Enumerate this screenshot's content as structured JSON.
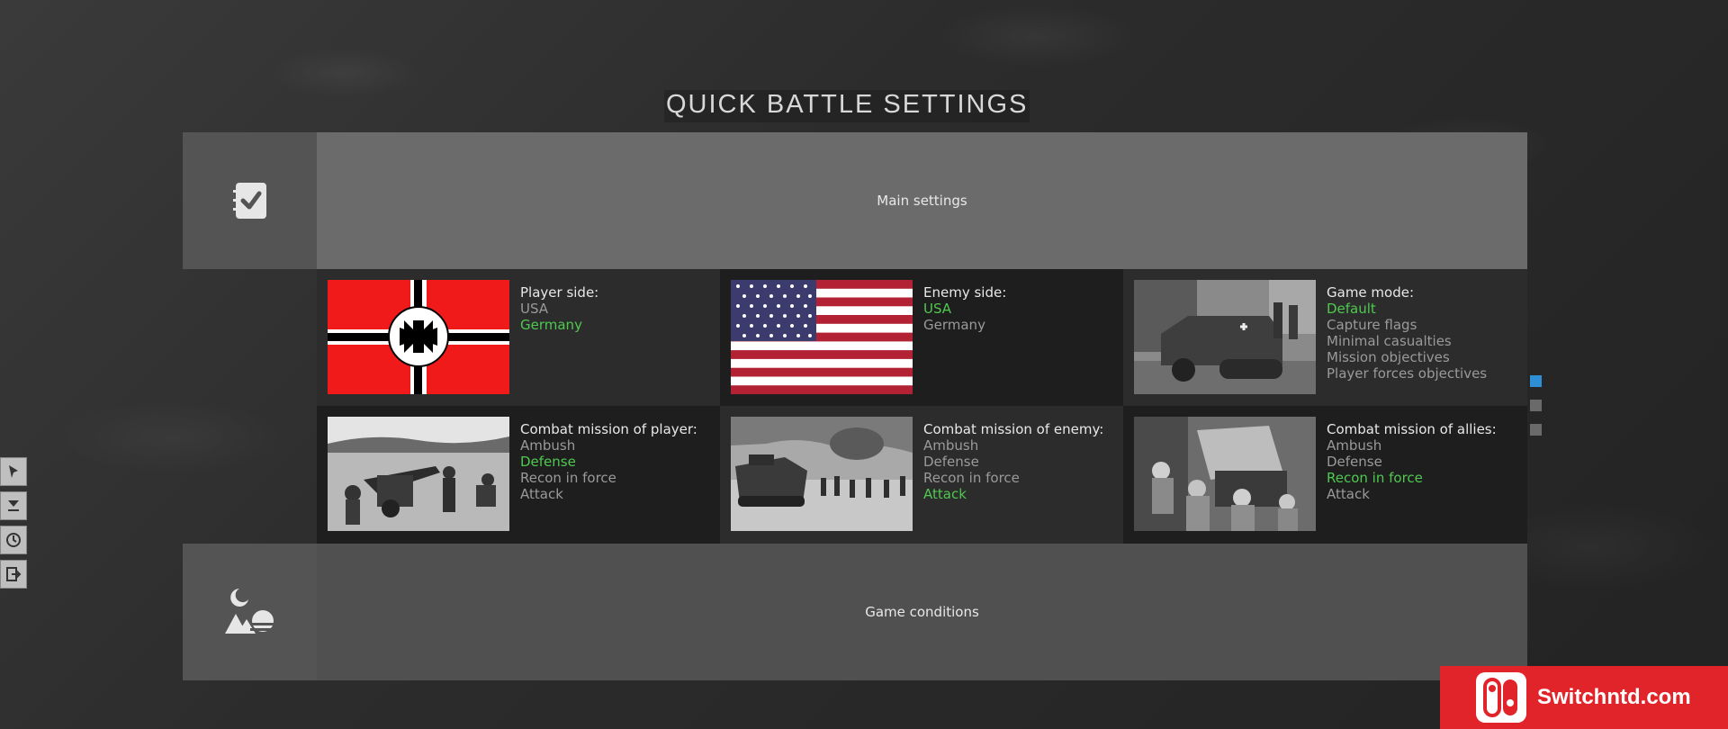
{
  "title": "QUICK BATTLE SETTINGS",
  "main_settings": {
    "label": "Main settings",
    "icon": "checklist-icon"
  },
  "game_conditions": {
    "label": "Game conditions",
    "icon": "landscape-icon"
  },
  "cells": [
    {
      "label": "Player side:",
      "options": [
        "USA",
        "Germany"
      ],
      "selected": 1,
      "image": "iron-cross-war-flag"
    },
    {
      "label": "Enemy side:",
      "options": [
        "USA",
        "Germany"
      ],
      "selected": 0,
      "image": "us-48-star-flag"
    },
    {
      "label": "Game mode:",
      "options": [
        "Default",
        "Capture flags",
        "Minimal casualties",
        "Mission objectives",
        "Player forces objectives"
      ],
      "selected": 0,
      "image": "halftrack-photo"
    },
    {
      "label": "Combat mission of player:",
      "options": [
        "Ambush",
        "Defense",
        "Recon in force",
        "Attack"
      ],
      "selected": 1,
      "image": "artillery-crew-photo"
    },
    {
      "label": "Combat mission of enemy:",
      "options": [
        "Ambush",
        "Defense",
        "Recon in force",
        "Attack"
      ],
      "selected": 3,
      "image": "tank-infantry-photo"
    },
    {
      "label": "Combat mission of allies:",
      "options": [
        "Ambush",
        "Defense",
        "Recon in force",
        "Attack"
      ],
      "selected": 2,
      "image": "soldiers-vehicle-photo"
    }
  ],
  "pager": {
    "pages": 3,
    "active": 0
  },
  "watermark": {
    "text": "Switchntd.com"
  },
  "colors": {
    "selected": "#4fc94f",
    "unselected": "#9a9a9a",
    "accent": "#2f8fd6"
  }
}
